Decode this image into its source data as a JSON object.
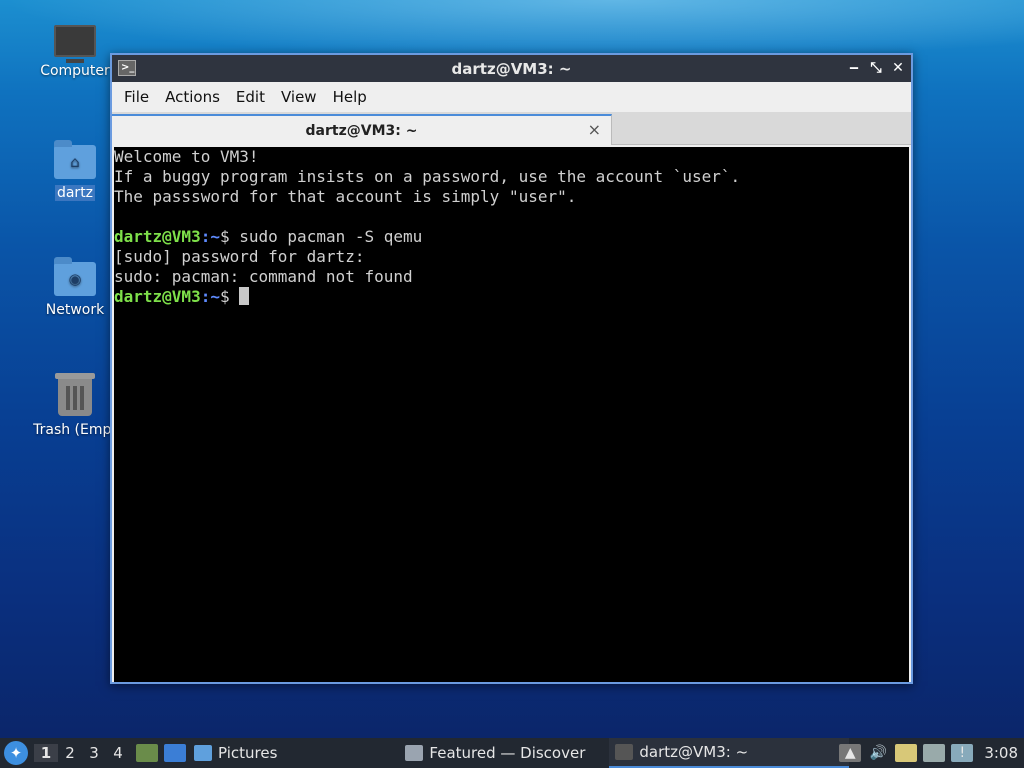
{
  "desktop": {
    "icons": [
      {
        "label": "Computer",
        "icon": "computer-icon"
      },
      {
        "label": "dartz",
        "icon": "home-folder-icon"
      },
      {
        "label": "Network",
        "icon": "network-folder-icon"
      },
      {
        "label": "Trash (Empt",
        "icon": "trash-icon"
      }
    ]
  },
  "window": {
    "title": "dartz@VM3: ~",
    "controls": {
      "minimize": "‒",
      "maximize": "⤡",
      "close": "✕"
    },
    "menu": [
      "File",
      "Actions",
      "Edit",
      "View",
      "Help"
    ],
    "tab": {
      "label": "dartz@VM3: ~",
      "close": "×"
    },
    "terminal": {
      "lines": [
        "Welcome to VM3!",
        "If a buggy program insists on a password, use the account `user`.",
        "The passsword for that account is simply \"user\".",
        "",
        "[sudo] password for dartz:",
        "sudo: pacman: command not found"
      ],
      "prompt_user": "dartz@VM3",
      "prompt_sep": ":",
      "prompt_path": "~",
      "prompt_end": "$",
      "command": " sudo pacman -S qemu"
    }
  },
  "taskbar": {
    "workspaces": [
      "1",
      "2",
      "3",
      "4"
    ],
    "tasks": [
      {
        "label": "Pictures",
        "icon": "folder-icon"
      },
      {
        "label": "Featured — Discover",
        "icon": "discover-icon"
      },
      {
        "label": "dartz@VM3: ~",
        "icon": "terminal-icon"
      }
    ],
    "clock": "3:08",
    "colors": {
      "accent": "#4a8bd9",
      "panel": "#222831"
    }
  }
}
